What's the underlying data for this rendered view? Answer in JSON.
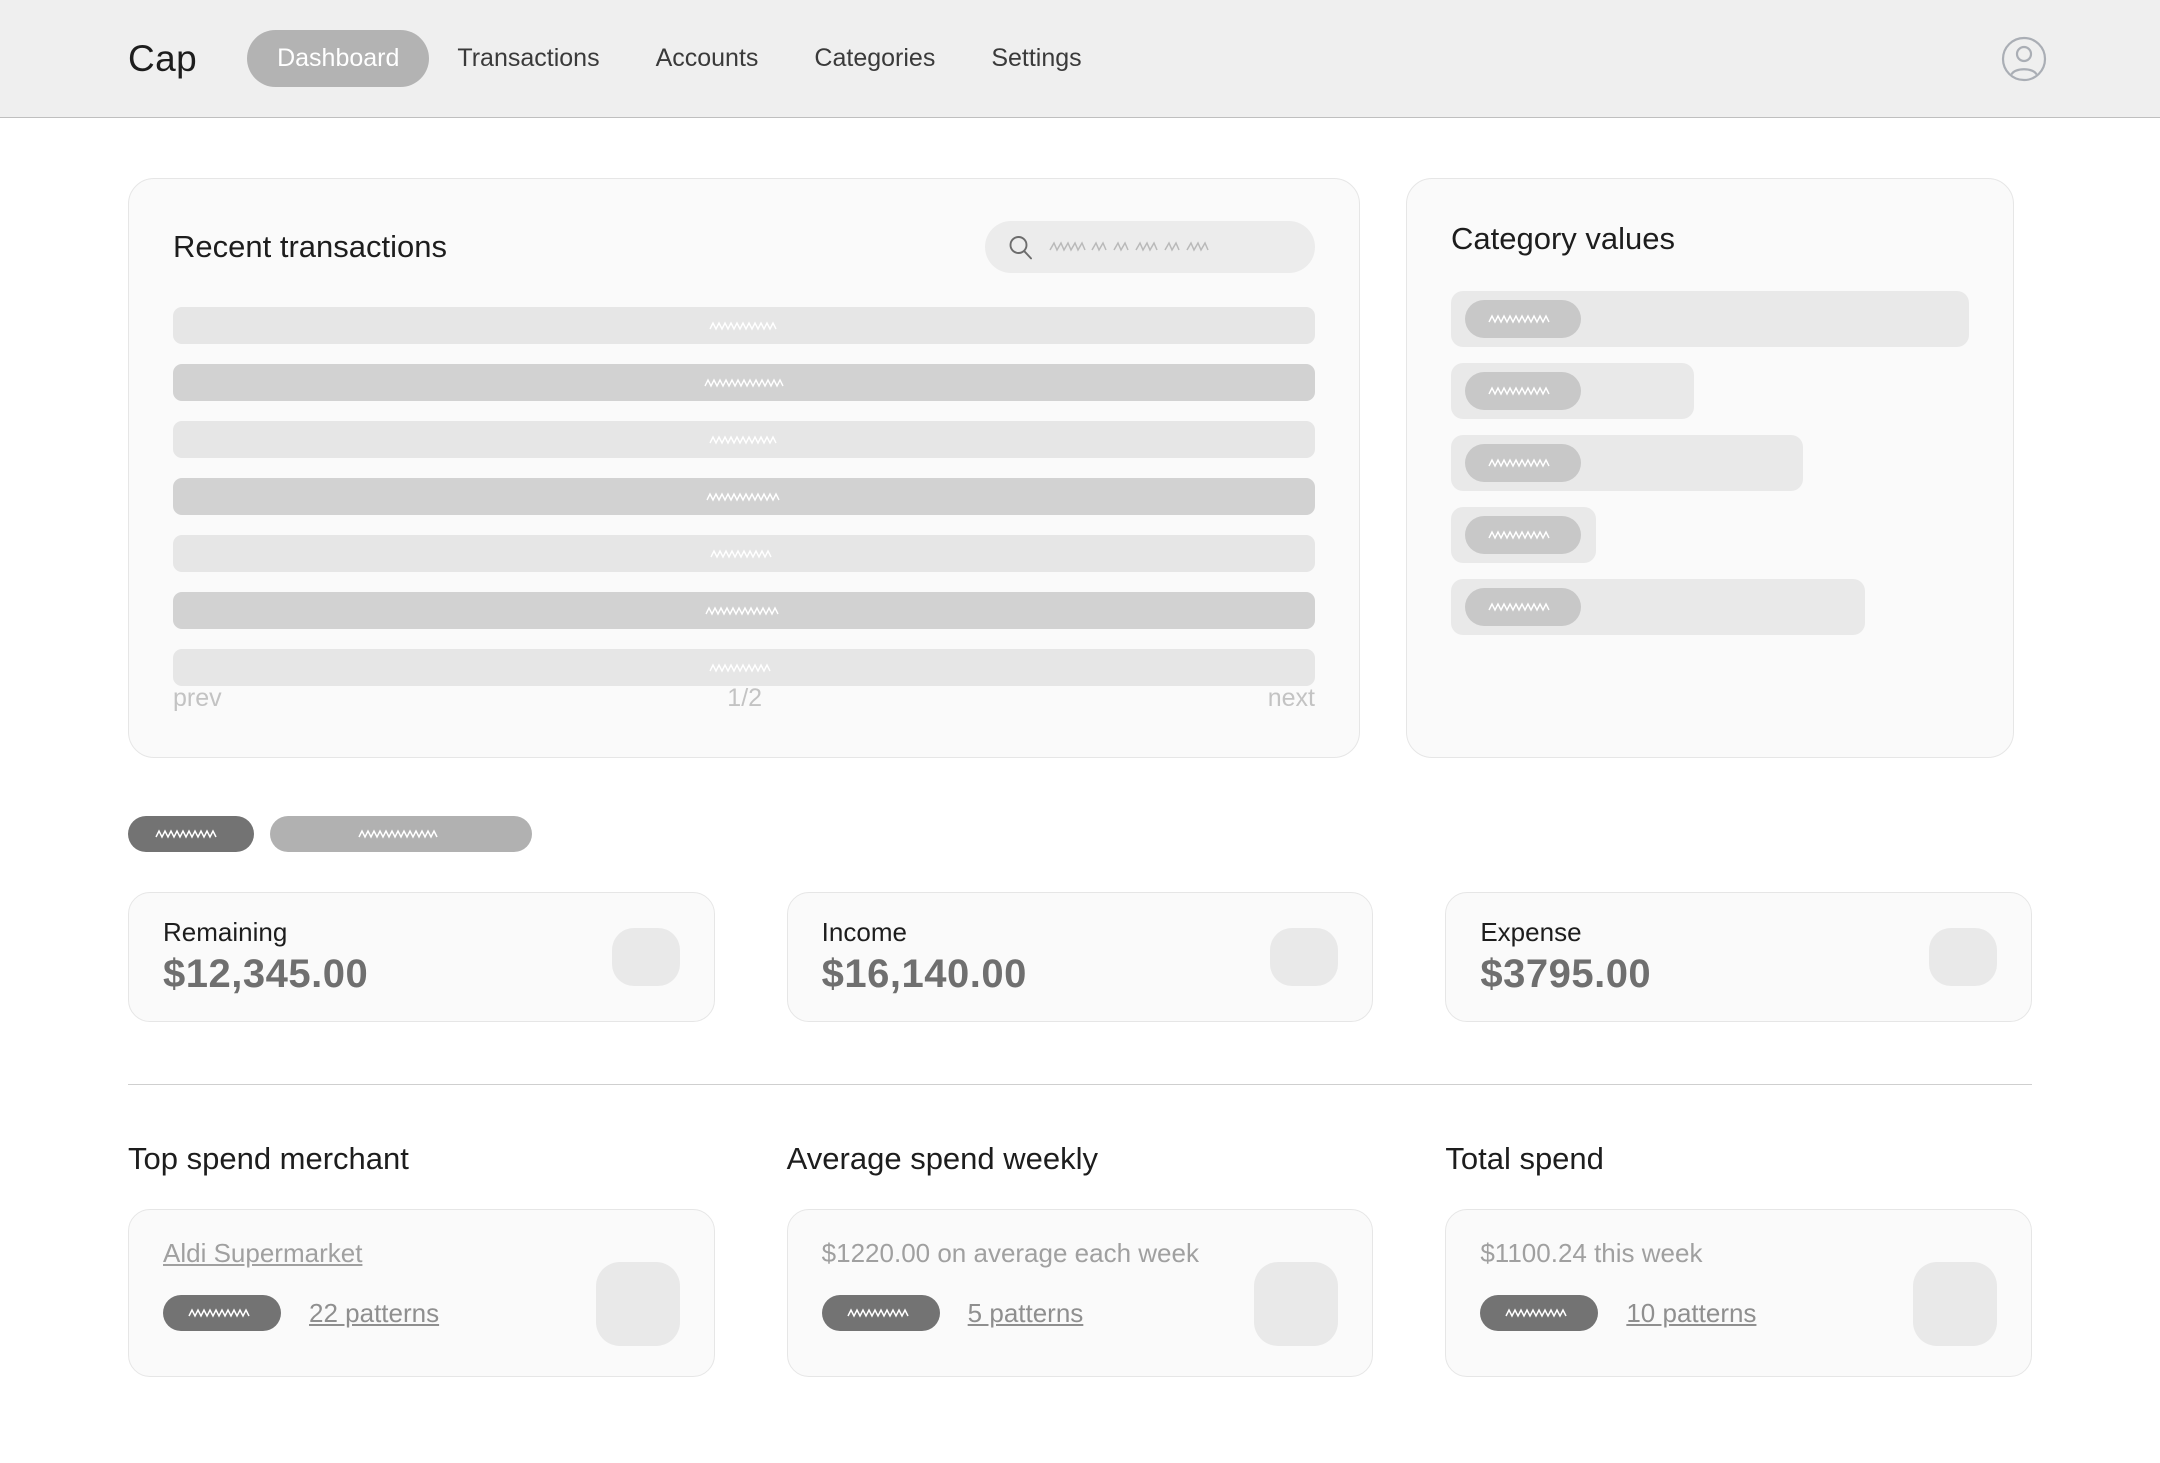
{
  "header": {
    "brand": "Cap",
    "nav": [
      {
        "label": "Dashboard",
        "active": true
      },
      {
        "label": "Transactions",
        "active": false
      },
      {
        "label": "Accounts",
        "active": false
      },
      {
        "label": "Categories",
        "active": false
      },
      {
        "label": "Settings",
        "active": false
      }
    ],
    "avatar_icon": "user-circle-icon"
  },
  "recent_transactions": {
    "title": "Recent transactions",
    "search": {
      "icon": "search-icon",
      "placeholder_scribble": true
    },
    "rows": [
      {
        "tone": "light"
      },
      {
        "tone": "dark"
      },
      {
        "tone": "light"
      },
      {
        "tone": "dark"
      },
      {
        "tone": "light"
      },
      {
        "tone": "dark"
      },
      {
        "tone": "light"
      }
    ],
    "pager": {
      "prev": "prev",
      "page": "1/2",
      "next": "next"
    }
  },
  "category_values": {
    "title": "Category values"
  },
  "chart_data": {
    "type": "bar",
    "title": "Category values",
    "orientation": "horizontal",
    "categories": [
      "Category 1",
      "Category 2",
      "Category 3",
      "Category 4",
      "Category 5"
    ],
    "values": [
      100,
      47,
      68,
      28,
      80
    ],
    "value_unit": "percent-of-track",
    "xlabel": "",
    "ylabel": "",
    "xlim": [
      0,
      100
    ],
    "grid": false,
    "legend": false,
    "labels_redacted": true,
    "bar_track_color": "#e9e9e9",
    "bar_label_color": "#c8c8c8"
  },
  "toggles": [
    {
      "state": "on"
    },
    {
      "state": "off"
    }
  ],
  "stats": [
    {
      "label": "Remaining",
      "value": "$12,345.00"
    },
    {
      "label": "Income",
      "value": "$16,140.00"
    },
    {
      "label": "Expense",
      "value": "$3795.00"
    }
  ],
  "insights": [
    {
      "title": "Top spend merchant",
      "lead": "Aldi Supermarket",
      "lead_is_link": true,
      "patterns": "22 patterns"
    },
    {
      "title": "Average spend weekly",
      "lead": "$1220.00 on average each week",
      "lead_is_link": false,
      "patterns": "5 patterns"
    },
    {
      "title": "Total spend",
      "lead": "$1100.24 this week",
      "lead_is_link": false,
      "patterns": "10 patterns"
    }
  ],
  "colors": {
    "page_bg": "#ffffff",
    "header_bg": "#efefef",
    "card_bg": "#fafafa",
    "card_border": "#e6e6e6",
    "row_light": "#e6e6e6",
    "row_dark": "#d2d2d2",
    "pill_active": "#737373",
    "pill_inactive": "#b1b1b1",
    "nav_active": "#b3b3b3",
    "text_dark": "#1d1d1d",
    "text_muted": "#a0a0a0",
    "value_gray": "#6f6f6f"
  }
}
